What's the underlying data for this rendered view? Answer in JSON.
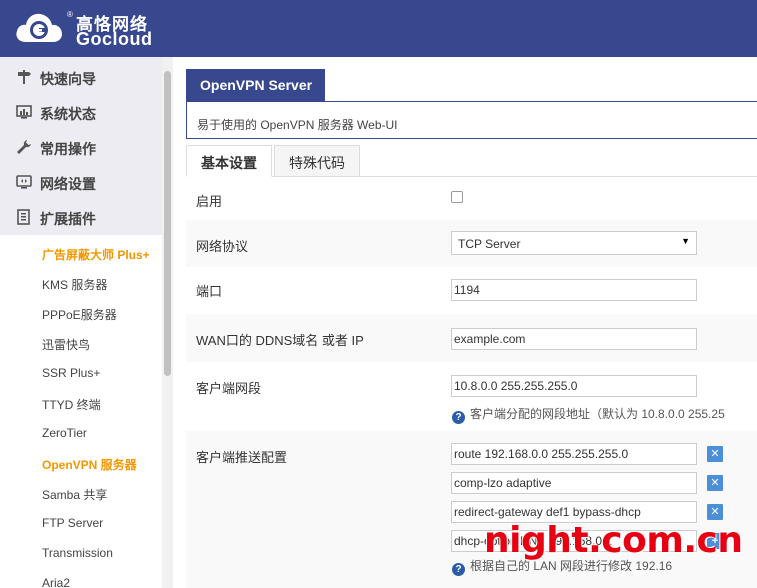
{
  "brand": {
    "name_cn": "高恪网络",
    "name_en": "Gocloud",
    "reg": "®"
  },
  "sidebar": {
    "menu": [
      {
        "label": "快速向导",
        "icon": "signpost-icon"
      },
      {
        "label": "系统状态",
        "icon": "dashboard-icon"
      },
      {
        "label": "常用操作",
        "icon": "wrench-icon"
      },
      {
        "label": "网络设置",
        "icon": "network-icon"
      },
      {
        "label": "扩展插件",
        "icon": "plugin-icon"
      }
    ],
    "submenu": [
      {
        "label": "广告屏蔽大师 Plus+",
        "active": true
      },
      {
        "label": "KMS 服务器"
      },
      {
        "label": "PPPoE服务器"
      },
      {
        "label": "迅雷快鸟"
      },
      {
        "label": "SSR Plus+"
      },
      {
        "label": "TTYD 终端"
      },
      {
        "label": "ZeroTier"
      },
      {
        "label": "OpenVPN 服务器",
        "active": true
      },
      {
        "label": "Samba 共享"
      },
      {
        "label": "FTP Server"
      },
      {
        "label": "Transmission"
      },
      {
        "label": "Aria2"
      }
    ]
  },
  "main": {
    "section_title": "OpenVPN Server",
    "description": "易于使用的 OpenVPN 服务器 Web-UI",
    "tabs": [
      {
        "label": "基本设置",
        "active": true
      },
      {
        "label": "特殊代码",
        "active": false
      }
    ],
    "fields": {
      "enable": {
        "label": "启用",
        "checked": false
      },
      "protocol": {
        "label": "网络协议",
        "value": "TCP Server"
      },
      "port": {
        "label": "端口",
        "value": "1194"
      },
      "ddns": {
        "label": "WAN口的 DDNS域名 或者 IP",
        "value": "example.com"
      },
      "subnet": {
        "label": "客户端网段",
        "value": "10.8.0.0 255.255.255.0",
        "help": "客户端分配的网段地址（默认为 10.8.0.0 255.25"
      },
      "push": {
        "label": "客户端推送配置",
        "values": [
          "route 192.168.0.0 255.255.255.0",
          "comp-lzo adaptive",
          "redirect-gateway def1 bypass-dhcp",
          "dhcp-option DNS 192.168.0.1"
        ],
        "help": "根据自己的 LAN 网段进行修改 192.16"
      }
    }
  },
  "watermark": "night.com.cn"
}
